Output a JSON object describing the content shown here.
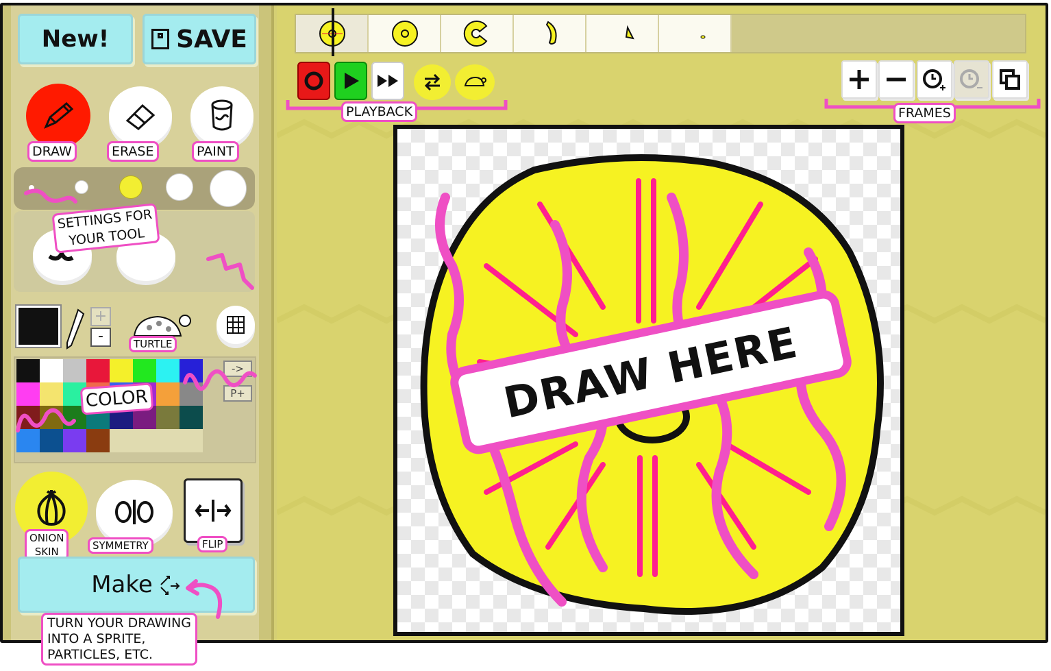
{
  "toolbar": {
    "new_label": "New!",
    "save_label": "SAVE"
  },
  "tools": {
    "draw_label": "DRAW",
    "erase_label": "ERASE",
    "paint_label": "PAINT"
  },
  "tool_settings_note": [
    "SETTINGS FOR",
    "YOUR TOOL"
  ],
  "turtle_label": "TURTLE",
  "color_note": "COLOR",
  "palette_buttons": {
    "next": "->",
    "add": "P+"
  },
  "size_stepper": {
    "plus": "+",
    "minus": "-"
  },
  "palette": [
    "#111111",
    "#ffffff",
    "#c4c4c4",
    "#e8173a",
    "#f4f02a",
    "#22e81f",
    "#2cf2f2",
    "#2620d8",
    "#ff3df2",
    "#f4e46e",
    "#2af0a0",
    "#f06a4a",
    "#3a60f0",
    "#a32ad0",
    "#f4a03a",
    "#888888",
    "#801c1c",
    "#806a10",
    "#1c7c1c",
    "#0c7a7a",
    "#1c1c80",
    "#7a1c80",
    "#7a7a3c",
    "#0c4c4c",
    "#2a86f0",
    "#0c5090",
    "#7a3cf0",
    "#8a3c10",
    "#e0dbb0",
    "#e0dbb0",
    "#e0dbb0",
    "#e0dbb0"
  ],
  "bottom_tools": {
    "onion_label_1": "ONION",
    "onion_label_2": "SKIN",
    "symmetry_label": "SYMMETRY",
    "flip_label": "FLIP"
  },
  "make": {
    "label": "Make",
    "note": [
      "TURN YOUR DRAWING",
      "INTO A SPRITE,",
      "PARTICLES, ETC."
    ]
  },
  "playback_label": "PLAYBACK",
  "frames_label": "FRAMES",
  "canvas_note": "DRAW HERE",
  "colors": {
    "accent_pink": "#ef4fc4",
    "sidebar": "#d8d19a",
    "workspace": "#d9d36e",
    "button_cyan": "#a4ecef",
    "draw_red": "#ff1a00",
    "play_green": "#1fd01f",
    "yellow_fill": "#f6f222"
  },
  "icons": {
    "save": "floppy-icon",
    "draw": "pencil-icon",
    "erase": "eraser-icon",
    "paint": "paint-bucket-icon",
    "record": "record-icon",
    "play": "play-icon",
    "fast_forward": "fast-forward-icon",
    "loop": "loop-arrows-icon",
    "speed": "turtle-speed-icon",
    "add_frame": "plus-icon",
    "remove_frame": "minus-icon",
    "add_time": "clock-plus-icon",
    "remove_time": "clock-minus-icon",
    "copy_frame": "copy-icon",
    "grid": "grid-icon",
    "eyedropper": "eyedropper-icon",
    "onion": "onion-icon",
    "symmetry": "symmetry-icon",
    "flip": "flip-icon"
  }
}
